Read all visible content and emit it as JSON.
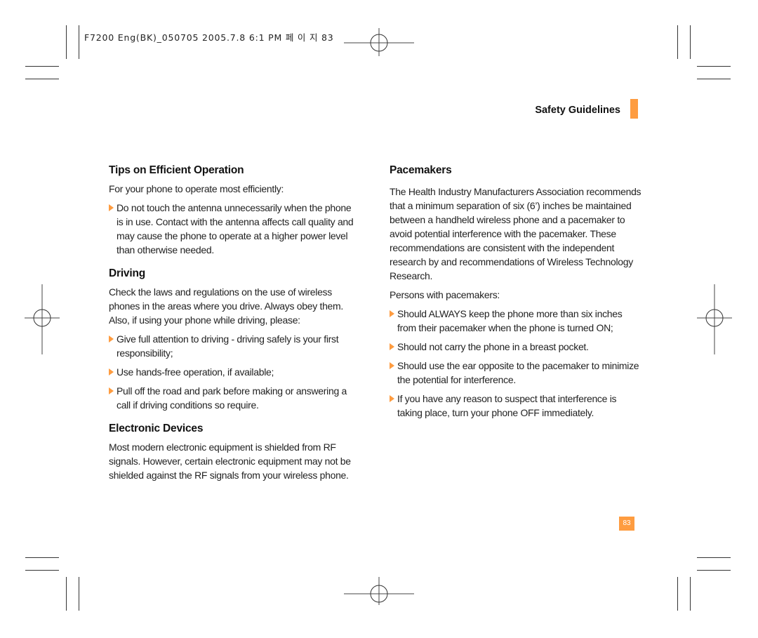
{
  "slug": {
    "text": "F7200 Eng(BK)_050705  2005.7.8  6:1 PM 페 이 지  83"
  },
  "header": {
    "section_title": "Safety Guidelines",
    "accent_color": "#fe9c40"
  },
  "left_column": {
    "sections": [
      {
        "heading": "Tips on Efficient Operation",
        "intro": "For your phone to operate most efficiently:",
        "bullets": [
          "Do not touch the antenna unnecessarily when the phone is in use. Contact with the antenna affects call quality and may cause the phone to operate at a higher power level than otherwise needed."
        ]
      },
      {
        "heading": "Driving",
        "intro": "Check the laws and regulations on the use of wireless phones in the areas where you drive. Always obey them. Also, if using your phone while driving, please:",
        "bullets": [
          "Give full attention to driving - driving safely is your first responsibility;",
          "Use hands-free operation, if available;",
          "Pull off the road and park before making or answering a call if driving conditions so require."
        ]
      },
      {
        "heading": "Electronic Devices",
        "intro": "Most modern electronic equipment is shielded from RF signals. However, certain electronic equipment may not be shielded against the RF signals from your wireless phone."
      }
    ]
  },
  "right_column": {
    "sections": [
      {
        "heading": "Pacemakers",
        "intro": "The Health Industry Manufacturers Association recommends that a minimum separation of six (6’) inches be maintained between a handheld wireless phone and a pacemaker to avoid potential interference with the pacemaker. These recommendations are consistent with the independent research by and recommendations of Wireless Technology Research.",
        "intro2": "Persons with pacemakers:",
        "bullets": [
          "Should ALWAYS keep the phone more than six inches from their pacemaker when the phone is turned ON;",
          "Should not carry the phone in a breast pocket.",
          "Should use the ear opposite to the pacemaker to minimize the potential for interference.",
          "If you have any reason to suspect that interference is taking place, turn your phone OFF immediately."
        ]
      }
    ]
  },
  "footer": {
    "page_number": "83"
  }
}
